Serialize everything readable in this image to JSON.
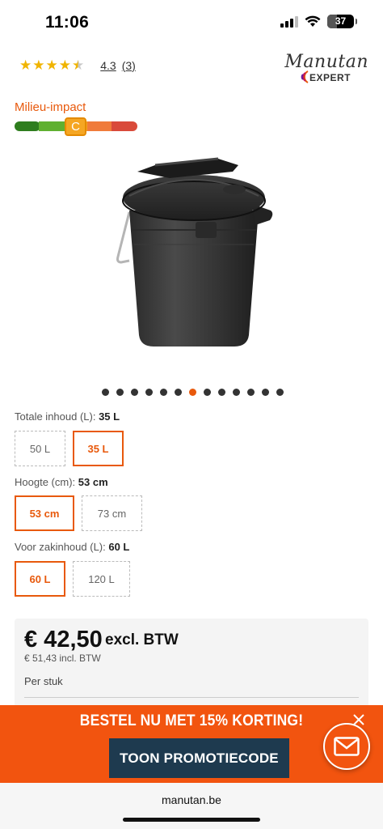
{
  "status_bar": {
    "time": "11:06",
    "battery": "37",
    "icons": [
      "signal-icon",
      "wifi-icon",
      "battery-icon"
    ]
  },
  "product": {
    "rating_value": "4.3",
    "rating_count": "(3)",
    "rating_stars": 4.3,
    "brand_logo": {
      "name": "Manutan",
      "sub": "EXPERT"
    },
    "milieu": {
      "label": "Milieu-impact",
      "grade": "C",
      "scale_colors": [
        "#2e7d1e",
        "#5fb030",
        "#f5a623",
        "#f07b3a",
        "#d94a3a"
      ]
    },
    "image_alt_icon": "trash-bin-image",
    "carousel": {
      "total": 13,
      "active_index": 6
    }
  },
  "variants": [
    {
      "label": "Totale inhoud (L):",
      "selected_value": "35 L",
      "options": [
        {
          "label": "50 L",
          "selected": false
        },
        {
          "label": "35 L",
          "selected": true
        }
      ]
    },
    {
      "label": "Hoogte (cm):",
      "selected_value": "53 cm",
      "options": [
        {
          "label": "53 cm",
          "selected": true
        },
        {
          "label": "73 cm",
          "selected": false
        }
      ]
    },
    {
      "label": "Voor zakinhoud (L):",
      "selected_value": "60 L",
      "options": [
        {
          "label": "60 L",
          "selected": true
        },
        {
          "label": "120 L",
          "selected": false
        }
      ]
    }
  ],
  "price": {
    "amount": "€ 42,50",
    "excl_label": "excl. BTW",
    "incl": "€ 51,43 incl. BTW",
    "unit": "Per stuk"
  },
  "promo": {
    "text_before": "BESTEL NU MET ",
    "text_highlight": "15% KORTING!",
    "button_label": "TOON PROMOTIECODE",
    "accent_color": "#f2540f",
    "button_color": "#1e3a4f"
  },
  "browser": {
    "url": "manutan.be"
  }
}
